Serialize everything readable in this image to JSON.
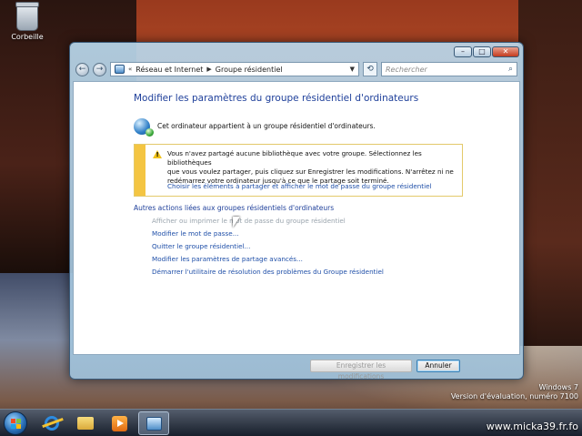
{
  "desktop": {
    "recycle_bin_label": "Corbeille"
  },
  "window": {
    "controls": {
      "minimize": "–",
      "maximize": "□",
      "close": "✕"
    }
  },
  "navigation": {
    "back": "←",
    "forward": "→",
    "breadcrumb": [
      "Réseau et Internet",
      "Groupe résidentiel"
    ],
    "refresh": "⟲",
    "search_placeholder": "Rechercher"
  },
  "main": {
    "title": "Modifier les paramètres du groupe résidentiel d'ordinateurs",
    "membership_text": "Cet ordinateur appartient à un groupe résidentiel d'ordinateurs.",
    "warning": {
      "lines": [
        "Vous n'avez partagé aucune bibliothèque avec votre groupe. Sélectionnez les bibliothèques",
        "que vous voulez partager, puis cliquez sur Enregistrer les modifications. N'arrêtez ni ne",
        "redémarrez votre ordinateur jusqu'à ce que le partage soit terminé."
      ],
      "link": "Choisir les éléments à partager et afficher le mot de passe du groupe résidentiel"
    },
    "actions_title": "Autres actions liées aux groupes résidentiels d'ordinateurs",
    "actions": [
      "Afficher ou imprimer le mot de passe du groupe résidentiel",
      "Modifier le mot de passe...",
      "Quitter le groupe résidentiel...",
      "Modifier les paramètres de partage avancés...",
      "Démarrer l'utilitaire de résolution des problèmes du Groupe résidentiel"
    ]
  },
  "footer": {
    "save_label": "Enregistrer les modifications",
    "cancel_label": "Annuler"
  },
  "watermark": {
    "line1": "Windows 7",
    "line2": "Version d'évaluation, numéro 7100"
  },
  "site": "www.micka39.fr.fo"
}
